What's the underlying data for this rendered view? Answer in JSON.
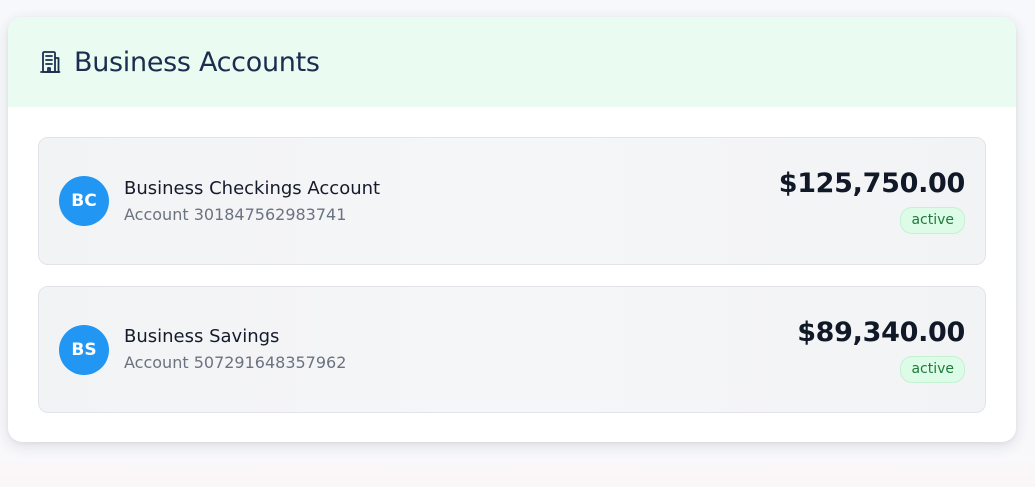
{
  "header": {
    "title": "Business Accounts",
    "icon": "building-icon"
  },
  "accounts": [
    {
      "initials": "BC",
      "name": "Business Checkings Account",
      "number_label": "Account",
      "number": "301847562983741",
      "balance": "$125,750.00",
      "status": "active"
    },
    {
      "initials": "BS",
      "name": "Business Savings",
      "number_label": "Account",
      "number": "507291648357962",
      "balance": "$89,340.00",
      "status": "active"
    }
  ],
  "colors": {
    "header_bg": "#eafcf2",
    "avatar": "#2196f3",
    "badge_bg": "#dcfce7",
    "badge_text": "#1f7a3c",
    "title": "#1c2d4f"
  }
}
